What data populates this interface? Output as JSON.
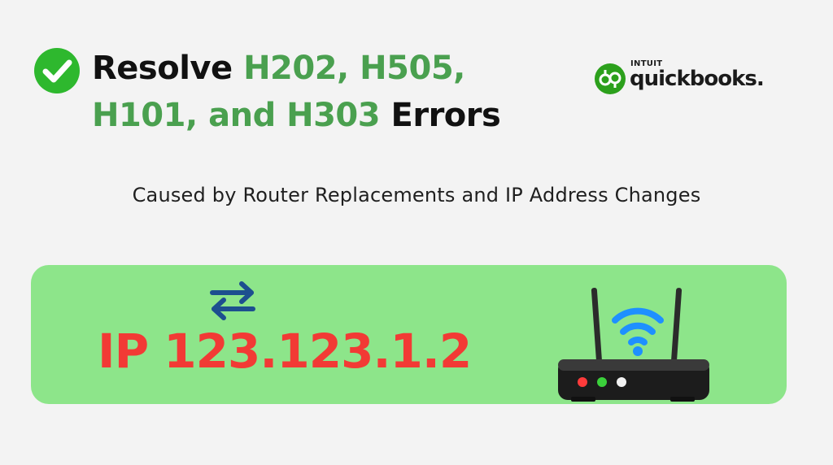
{
  "headline": {
    "resolve": "Resolve",
    "codes_line1": "H202, H505,",
    "codes_line2": "H101, and H303",
    "errors": "Errors"
  },
  "brand": {
    "intuit": "INTUIT",
    "name": "quickbooks",
    "registered": "."
  },
  "subtitle": "Caused by Router Replacements and IP Address Changes",
  "ip_label": "IP 123.123.1.2",
  "colors": {
    "accent_green": "#4aa04f",
    "panel_green": "#8de58a",
    "ip_red": "#f23a35",
    "arrow_blue": "#1d4f8f",
    "wifi_blue": "#1e90ff",
    "check_green": "#2eb82e"
  },
  "icons": {
    "check": "check-circle-icon",
    "swap": "swap-arrows-icon",
    "router": "wifi-router-icon",
    "brand": "quickbooks-logo-icon"
  }
}
